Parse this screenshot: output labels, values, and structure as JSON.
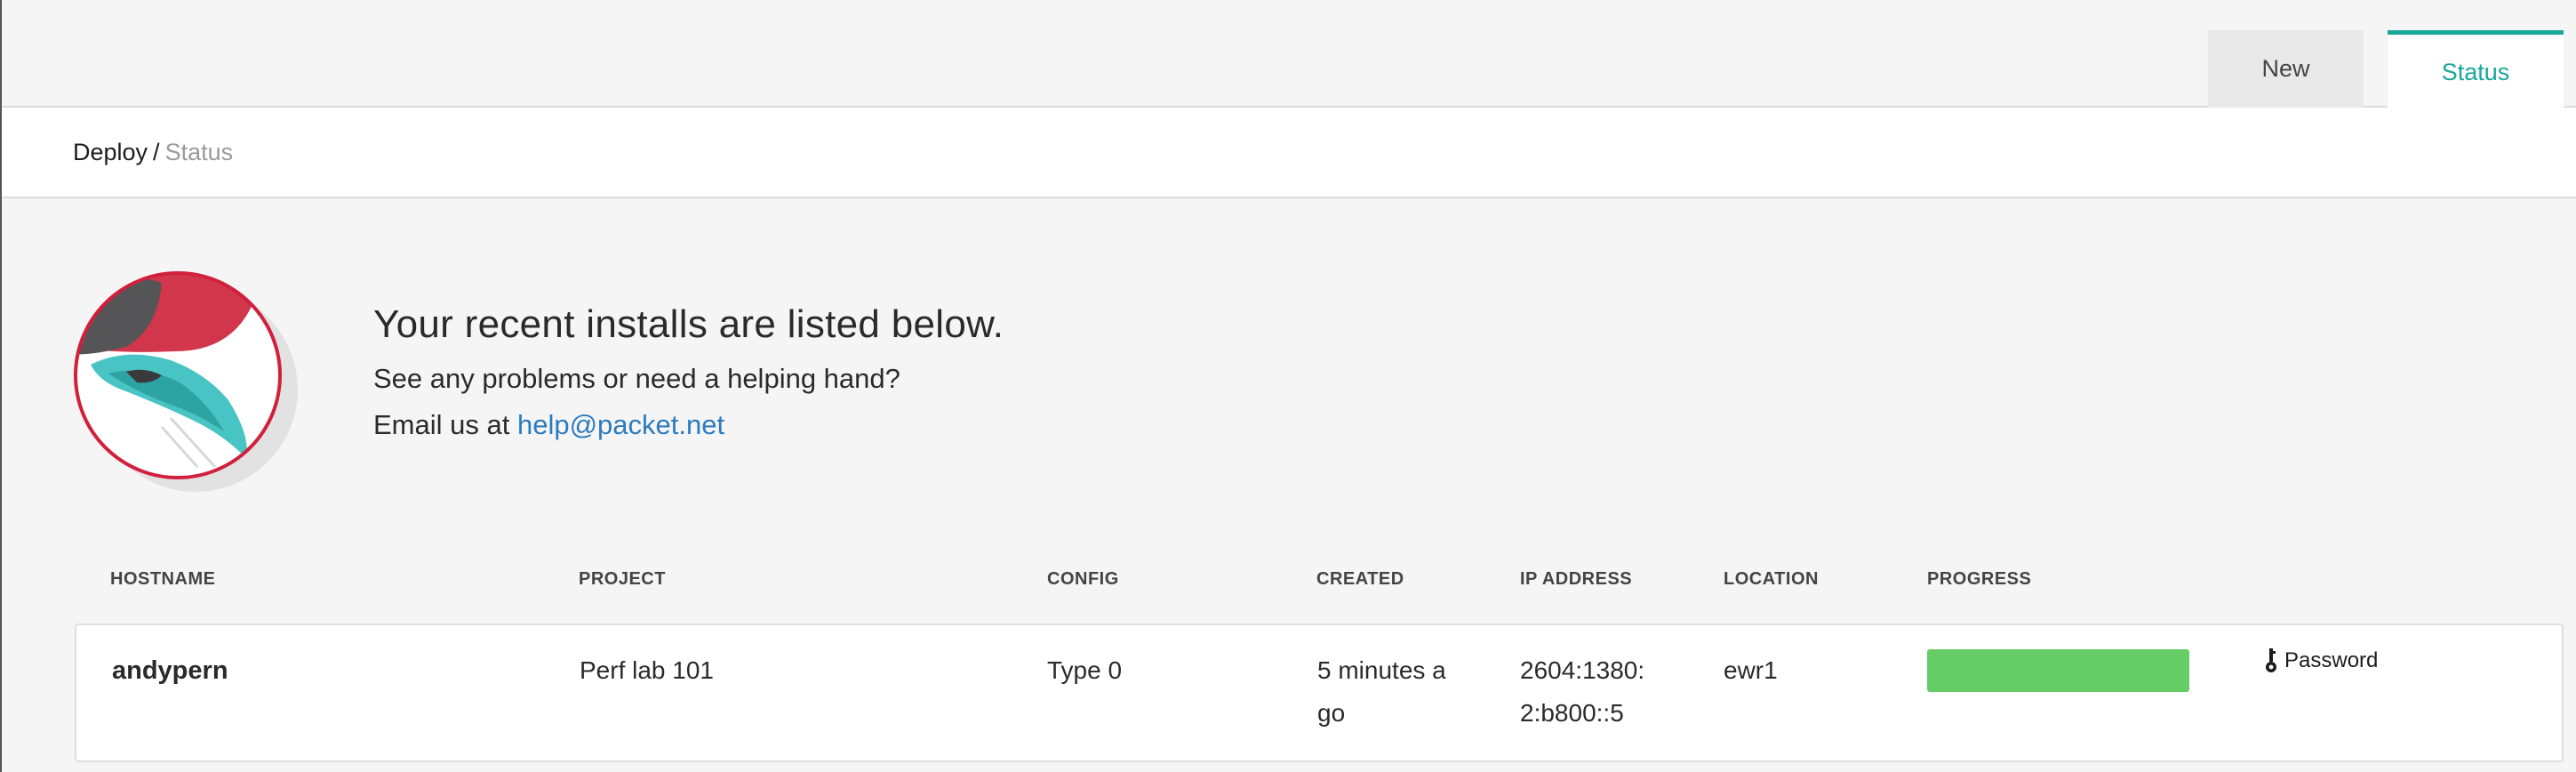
{
  "tabs": {
    "new_label": "New",
    "status_label": "Status"
  },
  "breadcrumb": {
    "root": "Deploy",
    "separator": "/",
    "current": "Status"
  },
  "hero": {
    "title": "Your recent installs are listed below.",
    "line1": "See any problems or need a helping hand?",
    "email_prefix": "Email us at",
    "email": "help@packet.net"
  },
  "table": {
    "headers": {
      "hostname": "HOSTNAME",
      "project": "PROJECT",
      "config": "CONFIG",
      "created": "CREATED",
      "ip_address": "IP ADDRESS",
      "location": "LOCATION",
      "progress": "PROGRESS"
    },
    "rows": [
      {
        "hostname": "andypern",
        "project": "Perf lab 101",
        "config": "Type 0",
        "created_line1": "5 minutes a",
        "created_line2": "go",
        "ip_line1": "2604:1380:",
        "ip_line2": "2:b800::5",
        "location": "ewr1",
        "progress_fraction": 1.0,
        "password_label": "Password",
        "password_icon": "key-icon"
      }
    ]
  },
  "colors": {
    "accent_teal": "#1aa79b",
    "link_blue": "#2c7bbf",
    "progress_green": "#66cc66",
    "mascot_red": "#d1364a"
  }
}
